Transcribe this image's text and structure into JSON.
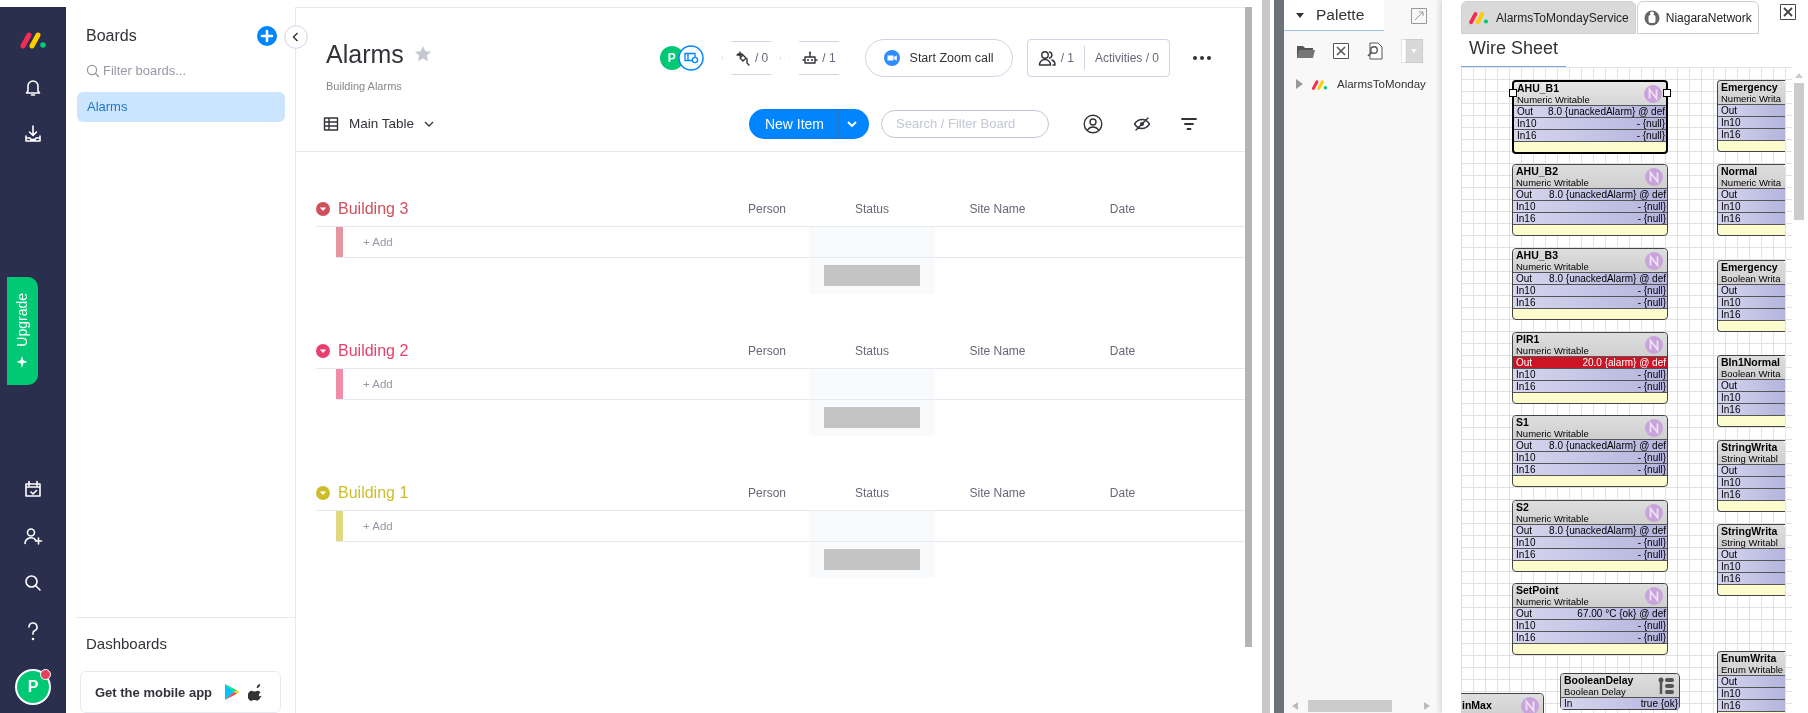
{
  "nav": {
    "upgrade": "Upgrade",
    "avatar": "P"
  },
  "sidebar": {
    "title": "Boards",
    "filter_placeholder": "Filter boards...",
    "items": [
      {
        "label": "Alarms",
        "selected": true
      }
    ],
    "dashboards": "Dashboards",
    "mobile_app": "Get the mobile app"
  },
  "board": {
    "title": "Alarms",
    "subtitle": "Building Alarms",
    "owner": "P",
    "integrations": "/ 0",
    "automations": "/ 1",
    "zoom": "Start Zoom call",
    "members": "/ 1",
    "activities": "Activities / 0",
    "view": "Main Table",
    "new_item": "New Item",
    "search_placeholder": "Search / Filter Board"
  },
  "groups": [
    {
      "name": "Building 3",
      "color": "#d0505c",
      "columns": [
        "Person",
        "Status",
        "Site Name",
        "Date"
      ],
      "add": "+ Add"
    },
    {
      "name": "Building 2",
      "color": "#e8406e",
      "columns": [
        "Person",
        "Status",
        "Site Name",
        "Date"
      ],
      "add": "+ Add"
    },
    {
      "name": "Building 1",
      "color": "#cdbd2a",
      "columns": [
        "Person",
        "Status",
        "Site Name",
        "Date"
      ],
      "add": "+ Add"
    }
  ],
  "palette": {
    "title": "Palette",
    "tree": [
      {
        "label": "AlarmsToMonday",
        "expanded": false
      }
    ]
  },
  "workspace": {
    "tabs": [
      {
        "label": "AlarmsToMondayService",
        "selected": false
      },
      {
        "label": "NiagaraNetwork",
        "selected": true
      }
    ],
    "view": "Wire Sheet",
    "nodes": [
      {
        "name": "AHU_B1",
        "type": "Numeric Writable",
        "kind": "writable",
        "selected": true,
        "slots": [
          {
            "name": "Out",
            "value": "8.0 {unackedAlarm} @ def",
            "alarm": false
          },
          {
            "name": "In10",
            "value": "- {null}",
            "alarm": false
          },
          {
            "name": "In16",
            "value": "- {null}",
            "alarm": false
          }
        ]
      },
      {
        "name": "AHU_B2",
        "type": "Numeric Writable",
        "kind": "writable",
        "selected": false,
        "slots": [
          {
            "name": "Out",
            "value": "8.0 {unackedAlarm} @ def",
            "alarm": false
          },
          {
            "name": "In10",
            "value": "- {null}",
            "alarm": false
          },
          {
            "name": "In16",
            "value": "- {null}",
            "alarm": false
          }
        ]
      },
      {
        "name": "AHU_B3",
        "type": "Numeric Writable",
        "kind": "writable",
        "selected": false,
        "slots": [
          {
            "name": "Out",
            "value": "8.0 {unackedAlarm} @ def",
            "alarm": false
          },
          {
            "name": "In10",
            "value": "- {null}",
            "alarm": false
          },
          {
            "name": "In16",
            "value": "- {null}",
            "alarm": false
          }
        ]
      },
      {
        "name": "PIR1",
        "type": "Numeric Writable",
        "kind": "writable",
        "selected": false,
        "slots": [
          {
            "name": "Out",
            "value": "20.0 {alarm} @ def",
            "alarm": true
          },
          {
            "name": "In10",
            "value": "- {null}",
            "alarm": false
          },
          {
            "name": "In16",
            "value": "- {null}",
            "alarm": false
          }
        ]
      },
      {
        "name": "S1",
        "type": "Numeric Writable",
        "kind": "writable",
        "selected": false,
        "slots": [
          {
            "name": "Out",
            "value": "8.0 {unackedAlarm} @ def",
            "alarm": false
          },
          {
            "name": "In10",
            "value": "- {null}",
            "alarm": false
          },
          {
            "name": "In16",
            "value": "- {null}",
            "alarm": false
          }
        ]
      },
      {
        "name": "S2",
        "type": "Numeric Writable",
        "kind": "writable",
        "selected": false,
        "slots": [
          {
            "name": "Out",
            "value": "8.0 {unackedAlarm} @ def",
            "alarm": false
          },
          {
            "name": "In10",
            "value": "- {null}",
            "alarm": false
          },
          {
            "name": "In16",
            "value": "- {null}",
            "alarm": false
          }
        ]
      },
      {
        "name": "SetPoint",
        "type": "Numeric Writable",
        "kind": "writable",
        "selected": false,
        "slots": [
          {
            "name": "Out",
            "value": "67.00 °C {ok} @ def",
            "alarm": false
          },
          {
            "name": "In10",
            "value": "- {null}",
            "alarm": false
          },
          {
            "name": "In16",
            "value": "- {null}",
            "alarm": false
          }
        ]
      },
      {
        "name": "Emergency",
        "type": "Numeric Writa",
        "kind": "writable",
        "selected": false,
        "slots": [
          {
            "name": "Out",
            "alarm": false
          },
          {
            "name": "In10",
            "alarm": false
          },
          {
            "name": "In16",
            "alarm": false
          }
        ]
      },
      {
        "name": "Normal",
        "type": "Numeric Writa",
        "kind": "writable",
        "selected": false,
        "slots": [
          {
            "name": "Out",
            "alarm": false
          },
          {
            "name": "In10",
            "alarm": false
          },
          {
            "name": "In16",
            "alarm": false
          }
        ]
      },
      {
        "name": "Emergency",
        "type": "Boolean Writa",
        "kind": "writable",
        "selected": false,
        "slots": [
          {
            "name": "Out",
            "alarm": false
          },
          {
            "name": "In10",
            "alarm": false
          },
          {
            "name": "In16",
            "alarm": false
          }
        ]
      },
      {
        "name": "BIn1Normal",
        "type": "Boolean Writa",
        "kind": "writable",
        "selected": false,
        "slots": [
          {
            "name": "Out",
            "alarm": false
          },
          {
            "name": "In10",
            "alarm": false
          },
          {
            "name": "In16",
            "alarm": false
          }
        ]
      },
      {
        "name": "StringWrita",
        "type": "String Writabl",
        "kind": "writable",
        "selected": false,
        "slots": [
          {
            "name": "Out",
            "alarm": false
          },
          {
            "name": "In10",
            "alarm": false
          },
          {
            "name": "In16",
            "alarm": false
          }
        ]
      },
      {
        "name": "StringWrita",
        "type": "String Writabl",
        "kind": "writable",
        "selected": false,
        "slots": [
          {
            "name": "Out",
            "alarm": false
          },
          {
            "name": "In10",
            "alarm": false
          },
          {
            "name": "In16",
            "alarm": false
          }
        ]
      },
      {
        "name": "inMax",
        "kind": "writable",
        "selected": false
      },
      {
        "name": "BooleanDelay",
        "type": "Boolean Delay",
        "kind": "delay",
        "selected": false,
        "slots": [
          {
            "name": "In",
            "value": "true {ok}",
            "alarm": false
          }
        ]
      },
      {
        "name": "EnumWrita",
        "type": "Enum Writable",
        "kind": "writable",
        "selected": false,
        "slots": [
          {
            "name": "Out",
            "alarm": false
          },
          {
            "name": "In10",
            "alarm": false
          },
          {
            "name": "In16",
            "alarm": false
          }
        ]
      }
    ]
  }
}
